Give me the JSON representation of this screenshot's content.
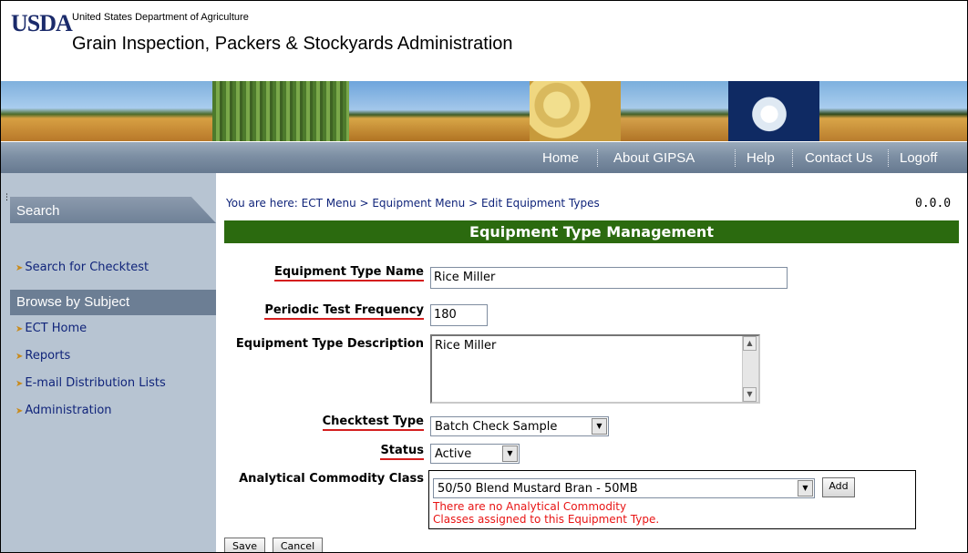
{
  "header": {
    "logo": "USDA",
    "department": "United States Department of Agriculture",
    "agency": "Grain Inspection, Packers & Stockyards Administration"
  },
  "topnav": {
    "items": [
      "Home",
      "About GIPSA",
      "Help",
      "Contact Us",
      "Logoff"
    ]
  },
  "sidebar": {
    "search_heading": "Search",
    "search_link": "Search for Checktest",
    "browse_heading": "Browse by Subject",
    "links": [
      "ECT Home",
      "Reports",
      "E-mail Distribution Lists",
      "Administration"
    ]
  },
  "breadcrumb": "You are here: ECT Menu > Equipment Menu > Edit Equipment Types",
  "version": "0.0.0",
  "page_title": "Equipment Type Management",
  "form": {
    "name_label": "Equipment Type Name",
    "name_value": "Rice Miller",
    "freq_label": "Periodic Test Frequency",
    "freq_value": "180",
    "desc_label": "Equipment Type Description",
    "desc_value": "Rice Miller",
    "checktest_label": "Checktest Type",
    "checktest_value": "Batch Check Sample",
    "status_label": "Status",
    "status_value": "Active",
    "acc_label": "Analytical Commodity Class",
    "acc_value": "50/50 Blend Mustard Bran - 50MB",
    "add_label": "Add",
    "acc_message_line1": "There are no Analytical Commodity",
    "acc_message_line2": "Classes assigned to this Equipment Type.",
    "save_label": "Save",
    "cancel_label": "Cancel"
  },
  "colors": {
    "title_bar": "#2b6a0f",
    "nav_bar": "#7d8fa3",
    "sidebar_bg": "#b7c4d2",
    "link": "#10247a",
    "error": "#e81414",
    "required_underline": "#d41e1e"
  }
}
